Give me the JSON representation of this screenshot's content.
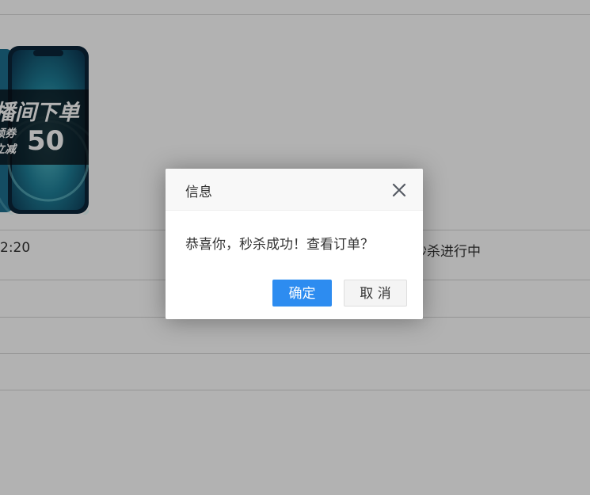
{
  "background": {
    "row_time_fragment": "2:20",
    "row_status_fragment": "秒杀进行中",
    "product_banner": {
      "line1": "播间下单",
      "line2a": "领券",
      "line2b": "立减",
      "amount": "50"
    }
  },
  "dialog": {
    "title": "信息",
    "message": "恭喜你，秒杀成功！查看订单？",
    "confirm_label": "确定",
    "cancel_label": "取 消",
    "close_icon": "close-icon"
  },
  "colors": {
    "accent": "#2d8cf0",
    "overlay": "rgba(0,0,0,0.30)"
  }
}
